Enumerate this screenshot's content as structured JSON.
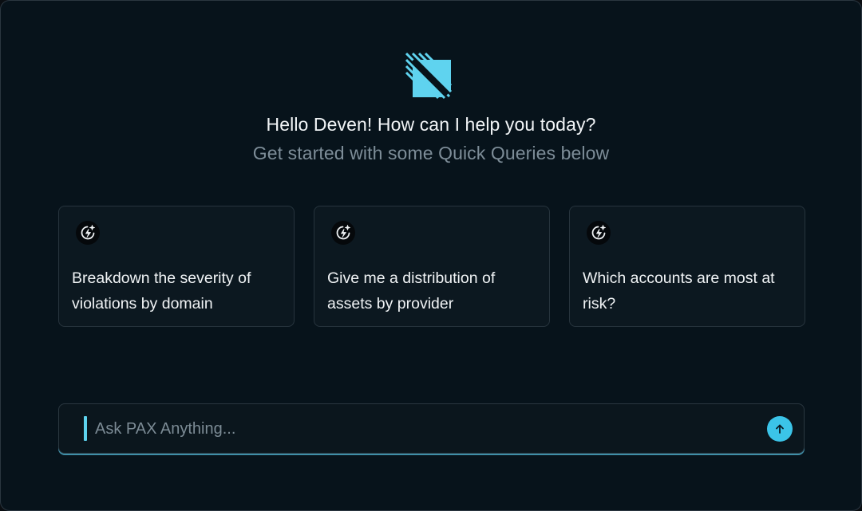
{
  "header": {
    "greeting": "Hello Deven! How can I help you today?",
    "subtitle": "Get started with some Quick Queries below",
    "logo_icon": "striped-square-logo"
  },
  "quick_queries": [
    {
      "icon": "sparkle-bolt-icon",
      "text": "Breakdown the severity of violations by domain"
    },
    {
      "icon": "sparkle-bolt-icon",
      "text": "Give me a distribution of assets by provider"
    },
    {
      "icon": "sparkle-bolt-icon",
      "text": "Which accounts are most at risk?"
    }
  ],
  "input": {
    "placeholder": "Ask PAX Anything...",
    "value": "",
    "send_icon": "arrow-up-icon"
  },
  "colors": {
    "background": "#07131b",
    "accent": "#3bc4e8",
    "card_background": "#0c1820",
    "muted_text": "#7d8d98"
  }
}
